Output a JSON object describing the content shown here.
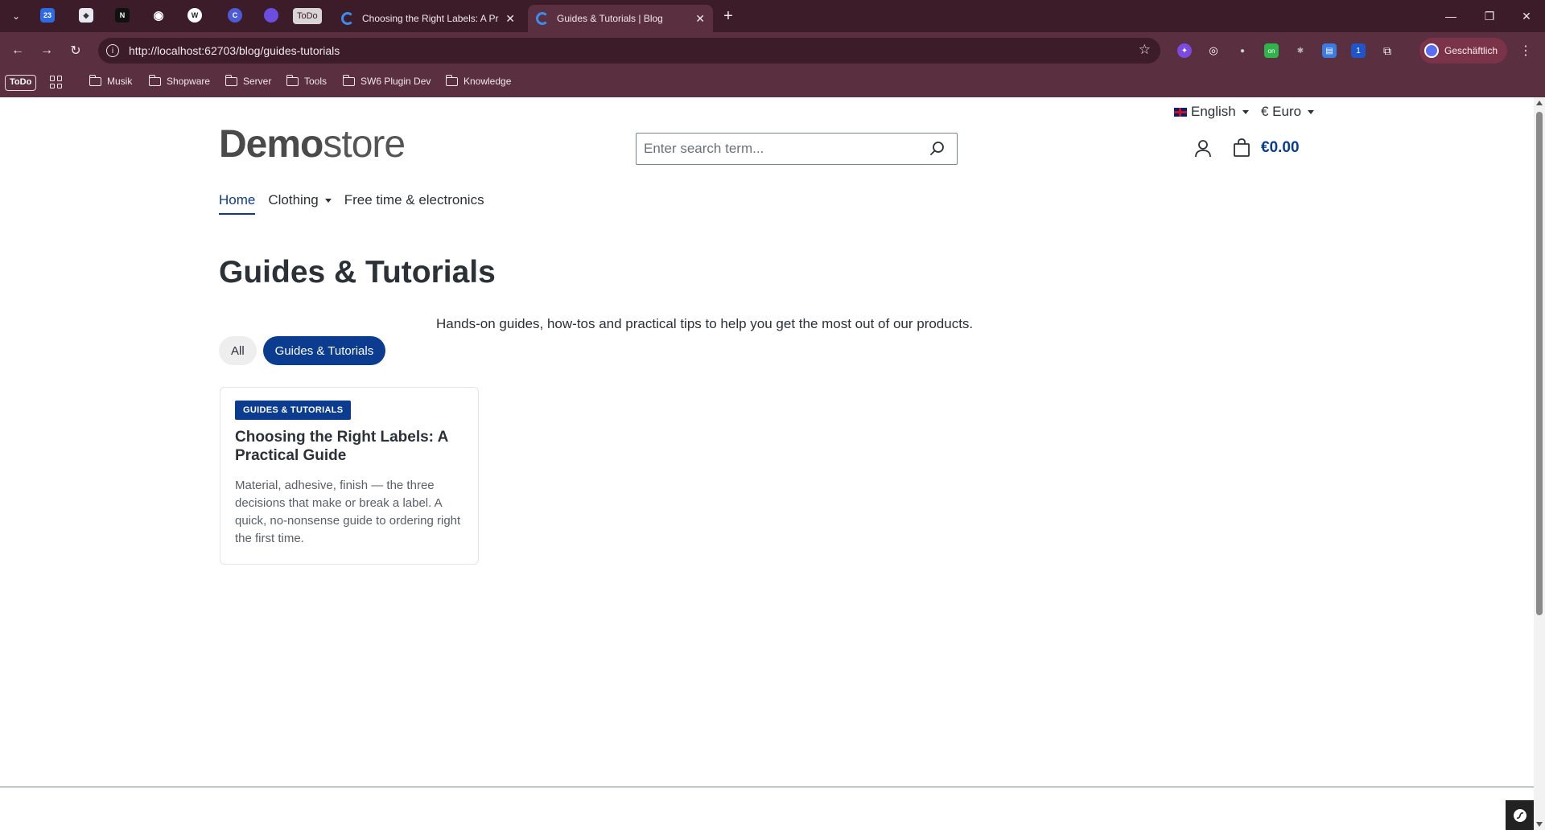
{
  "browser": {
    "todo_pill": "ToDo",
    "tabs": [
      {
        "title": "Choosing the Right Labels: A Practical Guide",
        "close": "✕"
      },
      {
        "title": "Guides & Tutorials | Blog",
        "close": "✕"
      }
    ],
    "new_tab": "+",
    "url": "http://localhost:62703/blog/guides-tutorials",
    "profile_label": "Geschäftlich",
    "bookmarks": {
      "todo": "ToDo",
      "folders": [
        "Musik",
        "Shopware",
        "Server",
        "Tools",
        "SW6 Plugin Dev",
        "Knowledge"
      ]
    }
  },
  "store": {
    "language": "English",
    "currency": "€ Euro",
    "logo_bold": "Demo",
    "logo_light": "store",
    "search_placeholder": "Enter search term...",
    "cart_total": "€0.00",
    "nav": [
      {
        "label": "Home",
        "active": true
      },
      {
        "label": "Clothing",
        "dropdown": true
      },
      {
        "label": "Free time & electronics"
      }
    ]
  },
  "blog": {
    "title": "Guides & Tutorials",
    "description": "Hands-on guides, how-tos and practical tips to help you get the most out of our products.",
    "filters": [
      {
        "label": "All",
        "active": false
      },
      {
        "label": "Guides & Tutorials",
        "active": true
      }
    ],
    "posts": [
      {
        "category": "GUIDES & TUTORIALS",
        "title": "Choosing the Right Labels: A Practical Guide",
        "excerpt": "Material, adhesive, finish — the three decisions that make or break a label. A quick, no-nonsense guide to ordering right the first time."
      }
    ]
  },
  "colors": {
    "brand": "#0b3c8f",
    "chrome_dark": "#3b1c28",
    "chrome": "#5a2f3f"
  }
}
